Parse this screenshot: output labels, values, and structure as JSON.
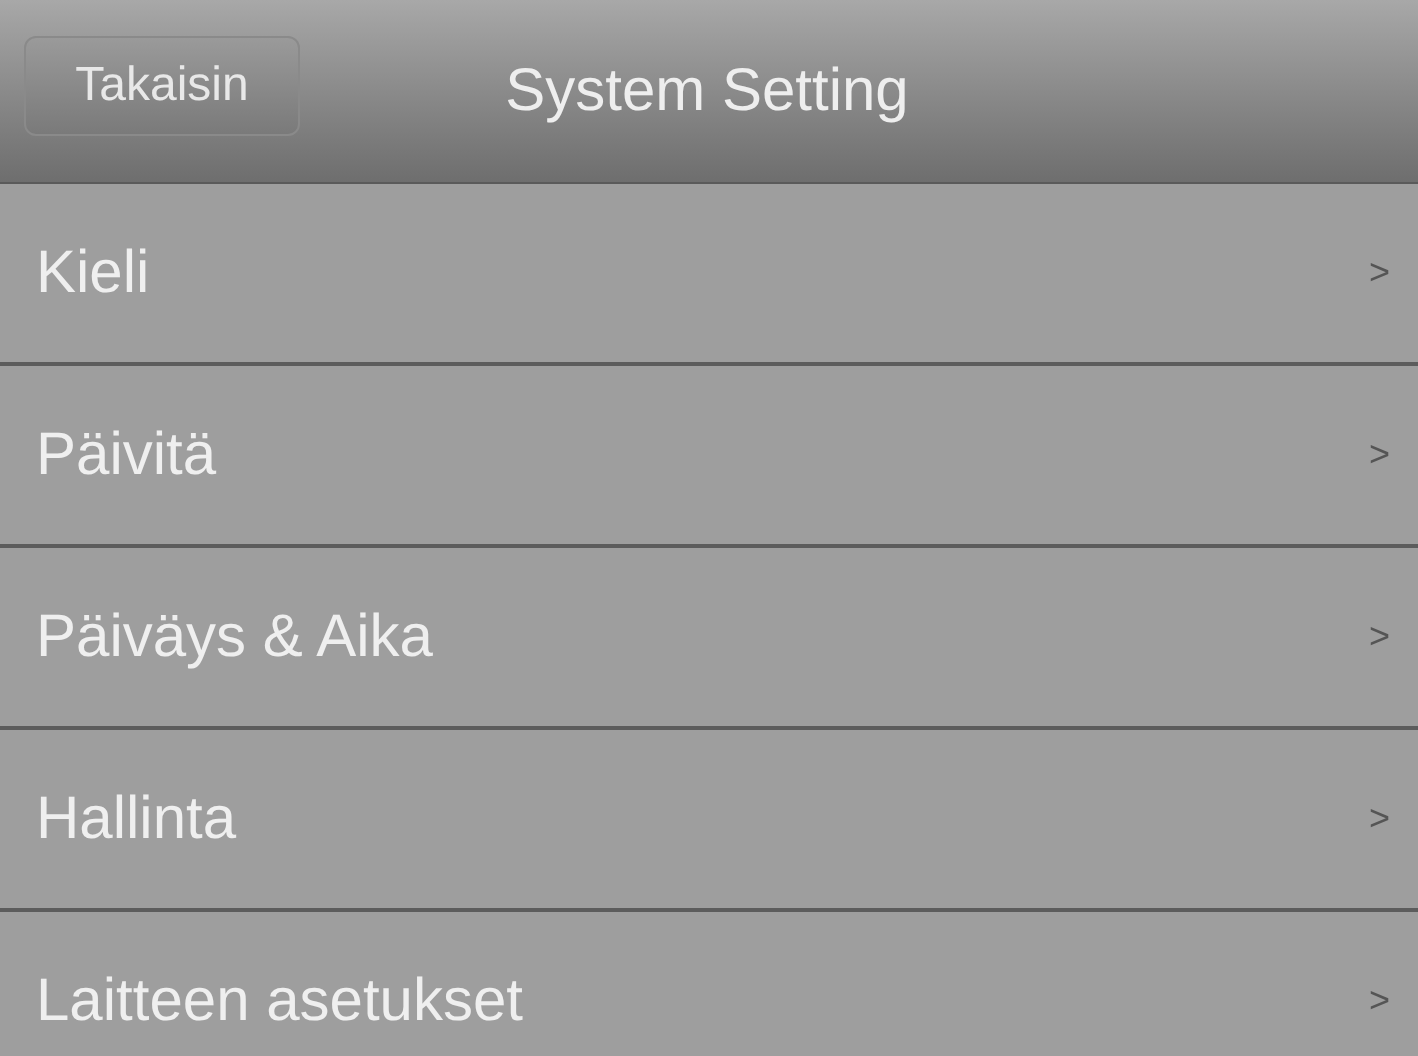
{
  "header": {
    "back_button": "Takaisin",
    "title": "System Setting"
  },
  "menu": [
    {
      "label": "Kieli",
      "arrow": ">"
    },
    {
      "label": "Päivitä",
      "arrow": ">"
    },
    {
      "label": "Päiväys & Aika",
      "arrow": ">"
    },
    {
      "label": "Hallinta",
      "arrow": ">"
    },
    {
      "label": "Laitteen asetukset",
      "arrow": ">"
    }
  ]
}
